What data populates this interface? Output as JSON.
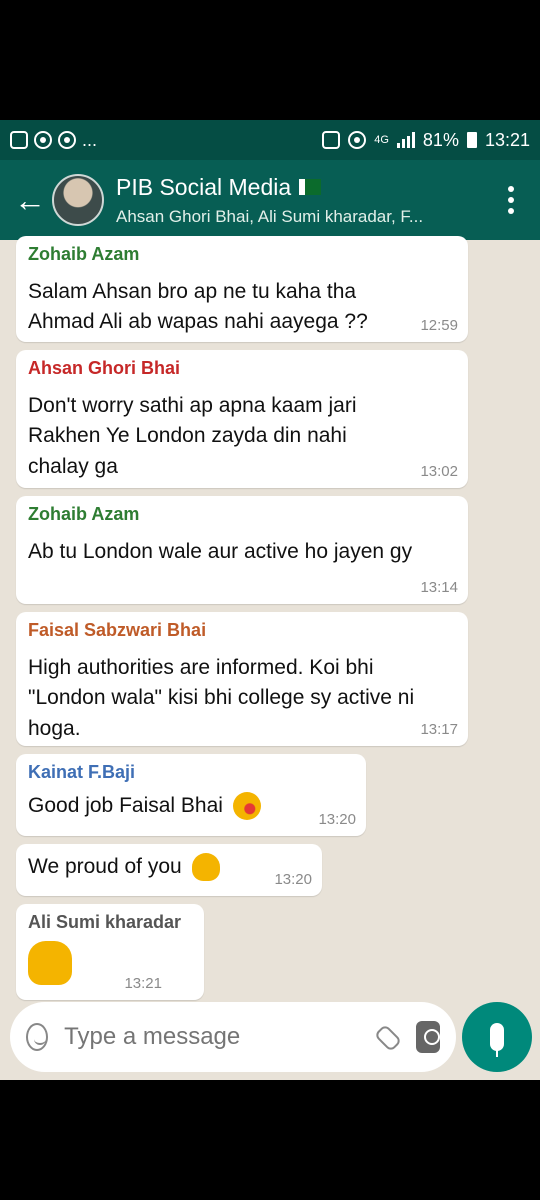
{
  "status_bar": {
    "left_more": "...",
    "network": "4G",
    "battery": "81%",
    "time": "13:21"
  },
  "header": {
    "title": "PIB Social Media",
    "subtitle": "Ahsan Ghori Bhai, Ali Sumi kharadar, F..."
  },
  "messages": [
    {
      "sender": "Zohaib Azam",
      "sender_color": "#2e7d32",
      "text": "Salam Ahsan bro ap ne tu kaha tha Ahmad Ali ab wapas nahi aayega ??",
      "time": "12:59"
    },
    {
      "sender": "Ahsan Ghori Bhai",
      "sender_color": "#c62828",
      "text": "Don't worry sathi ap apna kaam jari Rakhen Ye London zayda din nahi chalay ga",
      "time": "13:02"
    },
    {
      "sender": "Zohaib Azam",
      "sender_color": "#2e7d32",
      "text": "Ab tu London wale aur active ho jayen gy",
      "time": "13:14"
    },
    {
      "sender": "Faisal Sabzwari Bhai",
      "sender_color": "#bf5b28",
      "text": "High authorities are informed. Koi bhi \"London wala\" kisi bhi college sy active ni hoga.",
      "time": "13:17"
    },
    {
      "sender": "Kainat F.Baji",
      "sender_color": "#3f6fb5",
      "text": "Good job Faisal Bhai",
      "time": "13:20"
    },
    {
      "sender": "",
      "text": "We proud of you",
      "time": "13:20"
    },
    {
      "sender": "Ali Sumi kharadar",
      "sender_color": "#555555",
      "text": "",
      "time": "13:21"
    }
  ],
  "composer": {
    "placeholder": "Type a message"
  },
  "colors": {
    "header_bg": "#075e54",
    "status_bg": "#054d44",
    "chat_bg": "#e8e2d8",
    "mic_bg": "#00897b"
  }
}
